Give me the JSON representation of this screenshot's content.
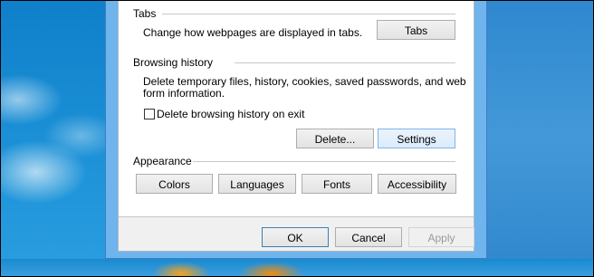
{
  "tabs_group": {
    "title": "Tabs",
    "description": "Change how webpages are displayed in tabs.",
    "button_label": "Tabs"
  },
  "history_group": {
    "title": "Browsing history",
    "description_line1": "Delete temporary files, history, cookies, saved passwords, and web",
    "description_line2": "form information.",
    "checkbox_label": "Delete browsing history on exit",
    "checkbox_checked": false,
    "delete_button": "Delete...",
    "settings_button": "Settings"
  },
  "appearance_group": {
    "title": "Appearance",
    "buttons": [
      "Colors",
      "Languages",
      "Fonts",
      "Accessibility"
    ]
  },
  "dialog_buttons": {
    "ok": "OK",
    "cancel": "Cancel",
    "apply": "Apply"
  },
  "colors": {
    "desktop": "#1a8ad0",
    "window_frame": "#6fb4ec",
    "focus_border": "#7eb4ea"
  }
}
